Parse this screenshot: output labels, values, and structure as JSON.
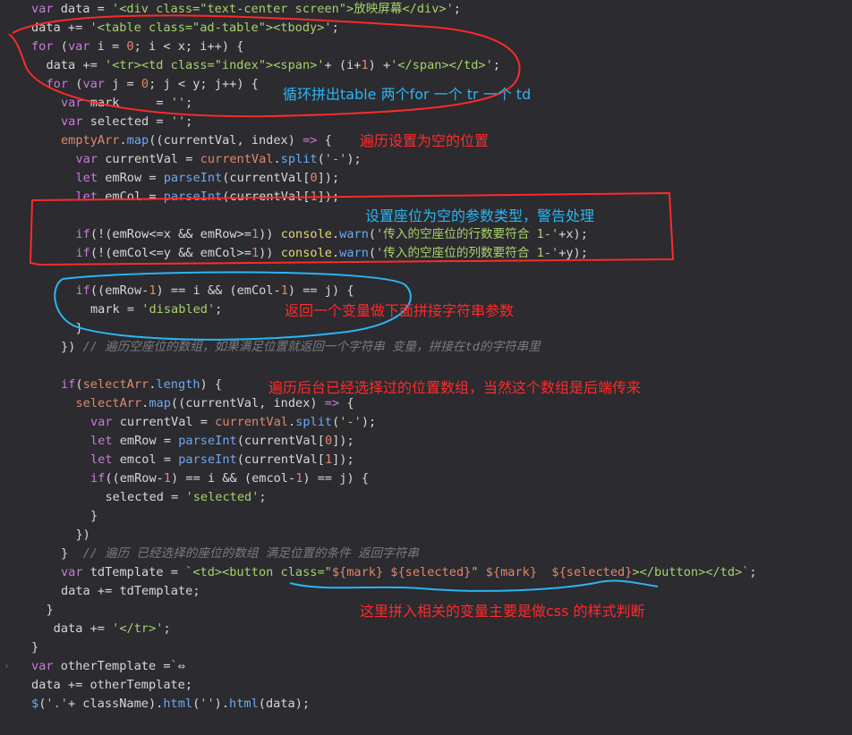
{
  "colors": {
    "background": "#2b2b30",
    "keyword": "#cc7ad8",
    "string": "#a9d26a",
    "number": "#e0896a",
    "function": "#6fa8f0",
    "method": "#e8d86a",
    "comment": "#7a7a82",
    "annotation_red": "#ff2a2a",
    "annotation_blue": "#29b6f6"
  },
  "gutter": {
    "fold_icon": "chevron-right-icon",
    "fold_glyph": "›"
  },
  "code_lines": [
    {
      "indent": 0,
      "tokens": [
        [
          "kw",
          "var"
        ],
        [
          "plain",
          " data = "
        ],
        [
          "str",
          "'<div class=\"text-center screen\">放映屏幕</div>'"
        ],
        [
          "plain",
          ";"
        ]
      ]
    },
    {
      "indent": 0,
      "tokens": [
        [
          "plain",
          "data += "
        ],
        [
          "str",
          "'<table class=\"ad-table\"><tbody>'"
        ],
        [
          "plain",
          ";"
        ]
      ]
    },
    {
      "indent": 0,
      "tokens": [
        [
          "kw",
          "for"
        ],
        [
          "plain",
          " ("
        ],
        [
          "kw",
          "var"
        ],
        [
          "plain",
          " i = "
        ],
        [
          "num",
          "0"
        ],
        [
          "plain",
          "; i < x; i++) {"
        ]
      ]
    },
    {
      "indent": 1,
      "tokens": [
        [
          "plain",
          "data += "
        ],
        [
          "str",
          "'<tr><td class=\"index\"><span>'"
        ],
        [
          "plain",
          "+ (i+"
        ],
        [
          "num",
          "1"
        ],
        [
          "plain",
          ") +"
        ],
        [
          "str",
          "'</span></td>'"
        ],
        [
          "plain",
          ";"
        ]
      ]
    },
    {
      "indent": 1,
      "tokens": [
        [
          "kw",
          "for"
        ],
        [
          "plain",
          " ("
        ],
        [
          "kw",
          "var"
        ],
        [
          "plain",
          " j = "
        ],
        [
          "num",
          "0"
        ],
        [
          "plain",
          "; j < y; j++) {"
        ]
      ]
    },
    {
      "indent": 2,
      "tokens": [
        [
          "kw",
          "var"
        ],
        [
          "plain",
          " mark     = "
        ],
        [
          "str",
          "''"
        ],
        [
          "plain",
          ";"
        ]
      ]
    },
    {
      "indent": 2,
      "tokens": [
        [
          "kw",
          "var"
        ],
        [
          "plain",
          " selected = "
        ],
        [
          "str",
          "''"
        ],
        [
          "plain",
          ";"
        ]
      ]
    },
    {
      "indent": 2,
      "tokens": [
        [
          "var",
          "emptyArr"
        ],
        [
          "plain",
          "."
        ],
        [
          "fn",
          "map"
        ],
        [
          "plain",
          "((currentVal, index) "
        ],
        [
          "kw",
          "=>"
        ],
        [
          "plain",
          " {"
        ]
      ]
    },
    {
      "indent": 3,
      "tokens": [
        [
          "kw",
          "var"
        ],
        [
          "plain",
          " currentVal = "
        ],
        [
          "var",
          "currentVal"
        ],
        [
          "plain",
          "."
        ],
        [
          "fn",
          "split"
        ],
        [
          "plain",
          "("
        ],
        [
          "str",
          "'-'"
        ],
        [
          "plain",
          ");"
        ]
      ]
    },
    {
      "indent": 3,
      "tokens": [
        [
          "kw",
          "let"
        ],
        [
          "plain",
          " emRow = "
        ],
        [
          "fn",
          "parseInt"
        ],
        [
          "plain",
          "(currentVal["
        ],
        [
          "num",
          "0"
        ],
        [
          "plain",
          "]);"
        ]
      ]
    },
    {
      "indent": 3,
      "tokens": [
        [
          "kw",
          "let"
        ],
        [
          "plain",
          " emCol = "
        ],
        [
          "fn",
          "parseInt"
        ],
        [
          "plain",
          "(currentVal["
        ],
        [
          "num",
          "1"
        ],
        [
          "plain",
          "]);"
        ]
      ]
    },
    {
      "indent": 0,
      "tokens": []
    },
    {
      "indent": 3,
      "tokens": [
        [
          "kw",
          "if"
        ],
        [
          "plain",
          "(!(emRow<=x && emRow>="
        ],
        [
          "num",
          "1"
        ],
        [
          "plain",
          ")) "
        ],
        [
          "method",
          "console"
        ],
        [
          "plain",
          "."
        ],
        [
          "fn",
          "warn"
        ],
        [
          "plain",
          "("
        ],
        [
          "str",
          "'传入的空座位的行数要符合 1-'"
        ],
        [
          "plain",
          "+x);"
        ]
      ]
    },
    {
      "indent": 3,
      "tokens": [
        [
          "kw",
          "if"
        ],
        [
          "plain",
          "(!(emCol<=y && emCol>="
        ],
        [
          "num",
          "1"
        ],
        [
          "plain",
          ")) "
        ],
        [
          "method",
          "console"
        ],
        [
          "plain",
          "."
        ],
        [
          "fn",
          "warn"
        ],
        [
          "plain",
          "("
        ],
        [
          "str",
          "'传入的空座位的列数要符合 1-'"
        ],
        [
          "plain",
          "+y);"
        ]
      ]
    },
    {
      "indent": 0,
      "tokens": []
    },
    {
      "indent": 3,
      "tokens": [
        [
          "kw",
          "if"
        ],
        [
          "plain",
          "((emRow-"
        ],
        [
          "num",
          "1"
        ],
        [
          "plain",
          ") == i && (emCol-"
        ],
        [
          "num",
          "1"
        ],
        [
          "plain",
          ") == j) {"
        ]
      ]
    },
    {
      "indent": 4,
      "tokens": [
        [
          "plain",
          "mark = "
        ],
        [
          "str",
          "'disabled'"
        ],
        [
          "plain",
          ";"
        ]
      ]
    },
    {
      "indent": 3,
      "tokens": [
        [
          "plain",
          "}"
        ]
      ]
    },
    {
      "indent": 2,
      "tokens": [
        [
          "plain",
          "}) "
        ],
        [
          "comment",
          "// 遍历空座位的数组，如果满足位置就返回一个字符串 变量，拼接在td的字符串里"
        ]
      ]
    },
    {
      "indent": 0,
      "tokens": []
    },
    {
      "indent": 2,
      "tokens": [
        [
          "kw",
          "if"
        ],
        [
          "plain",
          "("
        ],
        [
          "var",
          "selectArr"
        ],
        [
          "plain",
          "."
        ],
        [
          "fn",
          "length"
        ],
        [
          "plain",
          ") {"
        ]
      ]
    },
    {
      "indent": 3,
      "tokens": [
        [
          "var",
          "selectArr"
        ],
        [
          "plain",
          "."
        ],
        [
          "fn",
          "map"
        ],
        [
          "plain",
          "((currentVal, index) "
        ],
        [
          "kw",
          "=>"
        ],
        [
          "plain",
          " {"
        ]
      ]
    },
    {
      "indent": 4,
      "tokens": [
        [
          "kw",
          "var"
        ],
        [
          "plain",
          " currentVal = "
        ],
        [
          "var",
          "currentVal"
        ],
        [
          "plain",
          "."
        ],
        [
          "fn",
          "split"
        ],
        [
          "plain",
          "("
        ],
        [
          "str",
          "'-'"
        ],
        [
          "plain",
          ");"
        ]
      ]
    },
    {
      "indent": 4,
      "tokens": [
        [
          "kw",
          "let"
        ],
        [
          "plain",
          " emRow = "
        ],
        [
          "fn",
          "parseInt"
        ],
        [
          "plain",
          "(currentVal["
        ],
        [
          "num",
          "0"
        ],
        [
          "plain",
          "]);"
        ]
      ]
    },
    {
      "indent": 4,
      "tokens": [
        [
          "kw",
          "let"
        ],
        [
          "plain",
          " emcol = "
        ],
        [
          "fn",
          "parseInt"
        ],
        [
          "plain",
          "(currentVal["
        ],
        [
          "num",
          "1"
        ],
        [
          "plain",
          "]);"
        ]
      ]
    },
    {
      "indent": 4,
      "tokens": [
        [
          "kw",
          "if"
        ],
        [
          "plain",
          "((emRow-"
        ],
        [
          "num",
          "1"
        ],
        [
          "plain",
          ") == i && (emcol-"
        ],
        [
          "num",
          "1"
        ],
        [
          "plain",
          ") == j) {"
        ]
      ]
    },
    {
      "indent": 5,
      "tokens": [
        [
          "plain",
          "selected = "
        ],
        [
          "str",
          "'selected'"
        ],
        [
          "plain",
          ";"
        ]
      ]
    },
    {
      "indent": 4,
      "tokens": [
        [
          "plain",
          "}"
        ]
      ]
    },
    {
      "indent": 3,
      "tokens": [
        [
          "plain",
          "})"
        ]
      ]
    },
    {
      "indent": 2,
      "tokens": [
        [
          "plain",
          "}  "
        ],
        [
          "comment",
          "// 遍历 已经选择的座位的数组 满足位置的条件 返回字符串"
        ]
      ]
    },
    {
      "indent": 2,
      "tokens": [
        [
          "kw",
          "var"
        ],
        [
          "plain",
          " tdTemplate = "
        ],
        [
          "str",
          "`<td><button class=\""
        ],
        [
          "var",
          "${mark}"
        ],
        [
          "str",
          " "
        ],
        [
          "var",
          "${selected}"
        ],
        [
          "str",
          "\" "
        ],
        [
          "var",
          "${mark}"
        ],
        [
          "str",
          "  "
        ],
        [
          "var",
          "${selected}"
        ],
        [
          "str",
          "></button></td>`"
        ],
        [
          "plain",
          ";"
        ]
      ]
    },
    {
      "indent": 2,
      "tokens": [
        [
          "plain",
          "data += tdTemplate;"
        ]
      ]
    },
    {
      "indent": 1,
      "tokens": [
        [
          "plain",
          "}"
        ]
      ]
    },
    {
      "indent": 1,
      "tokens": [
        [
          "plain",
          " data += "
        ],
        [
          "str",
          "'</tr>'"
        ],
        [
          "plain",
          ";"
        ]
      ]
    },
    {
      "indent": 0,
      "tokens": [
        [
          "plain",
          "}"
        ]
      ]
    },
    {
      "indent": 0,
      "tokens": [
        [
          "kw",
          "var"
        ],
        [
          "plain",
          " otherTemplate ="
        ],
        [
          "str",
          "`"
        ],
        [
          "plain",
          "⇔"
        ]
      ]
    },
    {
      "indent": 0,
      "tokens": [
        [
          "plain",
          "data += otherTemplate;"
        ]
      ]
    },
    {
      "indent": 0,
      "tokens": [
        [
          "fn",
          "$"
        ],
        [
          "plain",
          "("
        ],
        [
          "str",
          "'.'"
        ],
        [
          "plain",
          "+ className)."
        ],
        [
          "fn",
          "html"
        ],
        [
          "plain",
          "("
        ],
        [
          "str",
          "''"
        ],
        [
          "plain",
          ")."
        ],
        [
          "fn",
          "html"
        ],
        [
          "plain",
          "(data);"
        ]
      ]
    }
  ],
  "annotations": {
    "loop_note": "循环拼出table 两个for 一个 tr 一个 td",
    "empty_note": "遍历设置为空的位置",
    "warn_note": "设置座位为空的参数类型，警告处理",
    "return_note": "返回一个变量做下面拼接字符串参数",
    "selected_note": "遍历后台已经选择过的位置数组，当然这个数组是后端传来",
    "css_note": "这里拼入相关的变量主要是做css 的样式判断"
  }
}
